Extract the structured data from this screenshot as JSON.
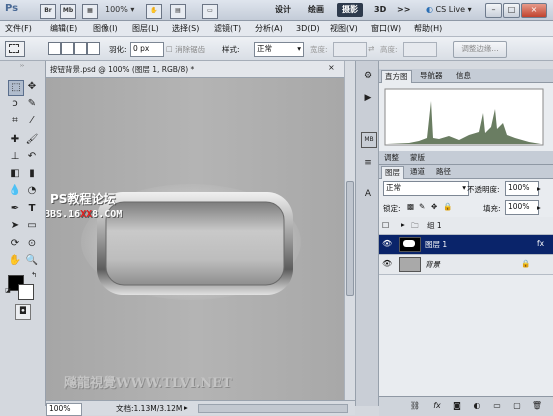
{
  "appbar": {
    "logo": "Ps",
    "icons": [
      "Br",
      "Mb"
    ],
    "zoom": "100%",
    "workspaces": [
      "设计",
      "绘画",
      "摄影",
      "3D"
    ],
    "active_workspace": "摄影",
    "more": ">>",
    "cslive": "CS Live",
    "window_buttons": [
      "–",
      "□",
      "×"
    ]
  },
  "menubar": [
    "文件(F)",
    "编辑(E)",
    "图像(I)",
    "图层(L)",
    "选择(S)",
    "滤镜(T)",
    "分析(A)",
    "3D(D)",
    "视图(V)",
    "窗口(W)",
    "帮助(H)"
  ],
  "options": {
    "feather_label": "羽化:",
    "feather_value": "0 px",
    "antialias_label": "消除锯齿",
    "style_label": "样式:",
    "style_value": "正常",
    "width_label": "宽度:",
    "height_label": "高度:",
    "refine_edge": "调整边缘..."
  },
  "document": {
    "tab_title": "按钮背景.psd @ 100% (图层 1, RGB/8) *",
    "watermark_cn": "PS教程论坛",
    "watermark_url_a": "BBS.16",
    "watermark_url_xx": "XX",
    "watermark_url_b": "8.COM",
    "watermark_tlvi": "飚龍視覺WWW.TLVI.NET",
    "zoom": "100%",
    "doc_size": "文档:1.13M/3.12M"
  },
  "panels": {
    "top_tabs": [
      "直方图",
      "导航器",
      "信息"
    ],
    "active_top_tab": "直方图",
    "adjust_tabs": [
      "调整",
      "蒙版"
    ],
    "layer_tabs": [
      "图层",
      "通道",
      "路径"
    ],
    "active_layer_tab": "图层",
    "blend_mode": "正常",
    "opacity_label": "不透明度:",
    "opacity_value": "100%",
    "lock_label": "锁定:",
    "fill_label": "填充:",
    "fill_value": "100%",
    "layers": [
      {
        "name": "组 1",
        "type": "group"
      },
      {
        "name": "图层 1",
        "type": "layer",
        "selected": true
      },
      {
        "name": "背景",
        "type": "background"
      }
    ]
  },
  "colors": {
    "selected_layer": "#0a246a",
    "active_workspace": "#2e3a4c",
    "watermark_red": "#e02020"
  }
}
